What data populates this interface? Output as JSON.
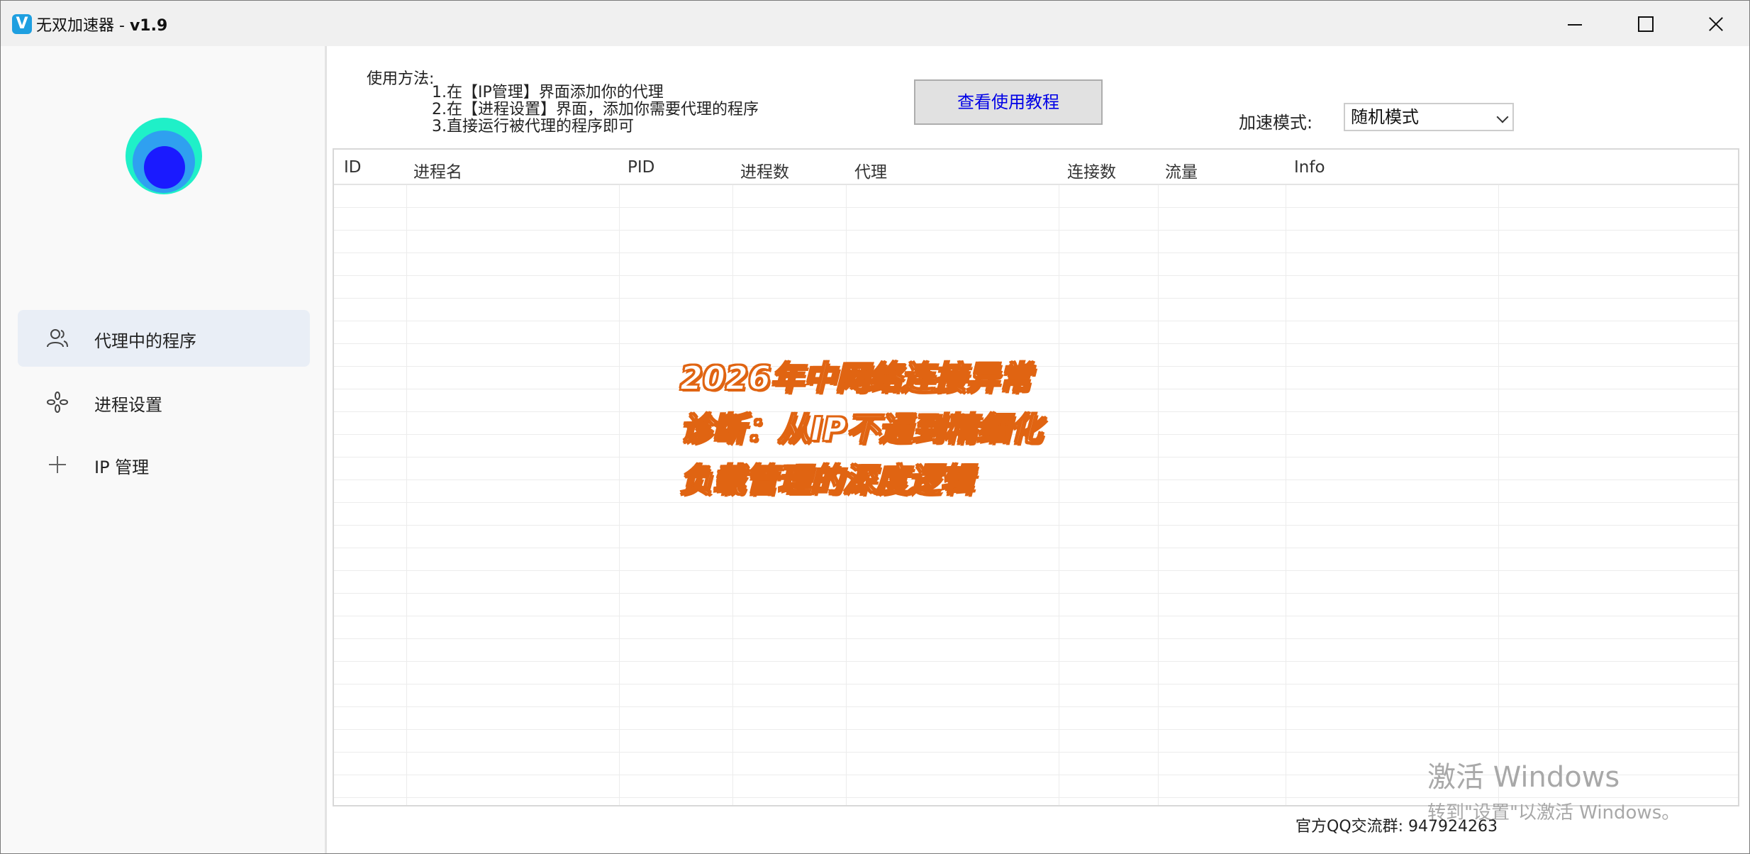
{
  "window": {
    "app_name": "无双加速器",
    "separator": " - ",
    "version": "v1.9"
  },
  "sidebar": {
    "items": [
      {
        "label": "代理中的程序",
        "icon": "users-icon"
      },
      {
        "label": "进程设置",
        "icon": "settings-cross-icon"
      },
      {
        "label": "IP 管理",
        "icon": "plus-icon"
      }
    ]
  },
  "usage": {
    "title": "使用方法:",
    "steps": [
      "1.在【IP管理】界面添加你的代理",
      "2.在【进程设置】界面，添加你需要代理的程序",
      "3.直接运行被代理的程序即可"
    ]
  },
  "tutorial_button": "查看使用教程",
  "mode": {
    "label": "加速模式:",
    "selected": "随机模式"
  },
  "table": {
    "columns": [
      "ID",
      "进程名",
      "PID",
      "进程数",
      "代理",
      "连接数",
      "流量",
      "Info"
    ],
    "rows": []
  },
  "footer": {
    "qq_group": "官方QQ交流群: 947924263"
  },
  "watermark": {
    "line1": "激活 Windows",
    "line2": "转到\"设置\"以激活 Windows。"
  },
  "overlay": {
    "lines": [
      "2026年中网络连接异常",
      "诊断：从IP不通到精细化",
      "负载管理的深度逻辑"
    ]
  },
  "colors": {
    "accent_blue": "#0000e6",
    "overlay_orange": "#e06412",
    "sidebar_active": "#e9eef6"
  }
}
